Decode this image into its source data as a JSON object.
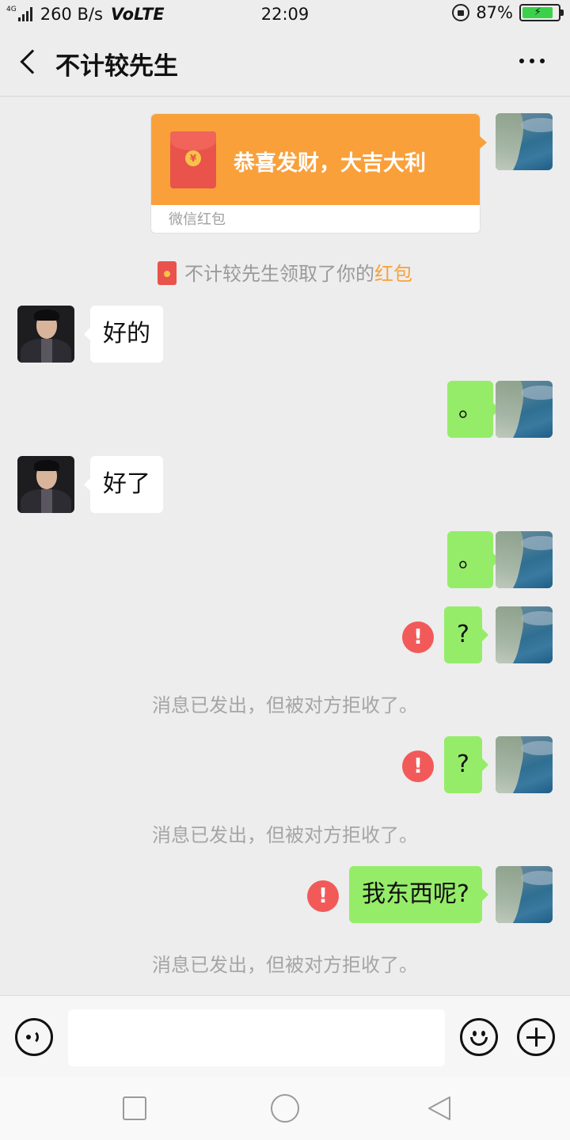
{
  "status_bar": {
    "network_tag": "4G",
    "speed": "260 B/s",
    "volte": "VoLTE",
    "time": "22:09",
    "battery": "87%"
  },
  "header": {
    "title": "不计较先生"
  },
  "red_packet": {
    "wish": "恭喜发财，大吉大利",
    "coin_symbol": "¥",
    "footer": "微信红包"
  },
  "claim_note": {
    "text": "不计较先生领取了你的",
    "highlight": "红包"
  },
  "messages": [
    {
      "from": "contact",
      "text": "好的"
    },
    {
      "from": "me",
      "text": "。"
    },
    {
      "from": "contact",
      "text": "好了"
    },
    {
      "from": "me",
      "text": "。"
    },
    {
      "from": "me",
      "text": "?",
      "error": true
    },
    {
      "from": "system",
      "text": "消息已发出，但被对方拒收了。"
    },
    {
      "from": "me",
      "text": "?",
      "error": true
    },
    {
      "from": "system",
      "text": "消息已发出，但被对方拒收了。"
    },
    {
      "from": "me",
      "text": "我东西呢?",
      "error": true
    },
    {
      "from": "system",
      "text": "消息已发出，但被对方拒收了。"
    }
  ],
  "error_mark": "!",
  "input_bar": {
    "value": "",
    "icons": [
      "voice-icon",
      "emoji-icon",
      "plus-icon"
    ]
  },
  "nav_bar": {
    "icons": [
      "recent-apps-icon",
      "home-icon",
      "back-icon"
    ]
  }
}
